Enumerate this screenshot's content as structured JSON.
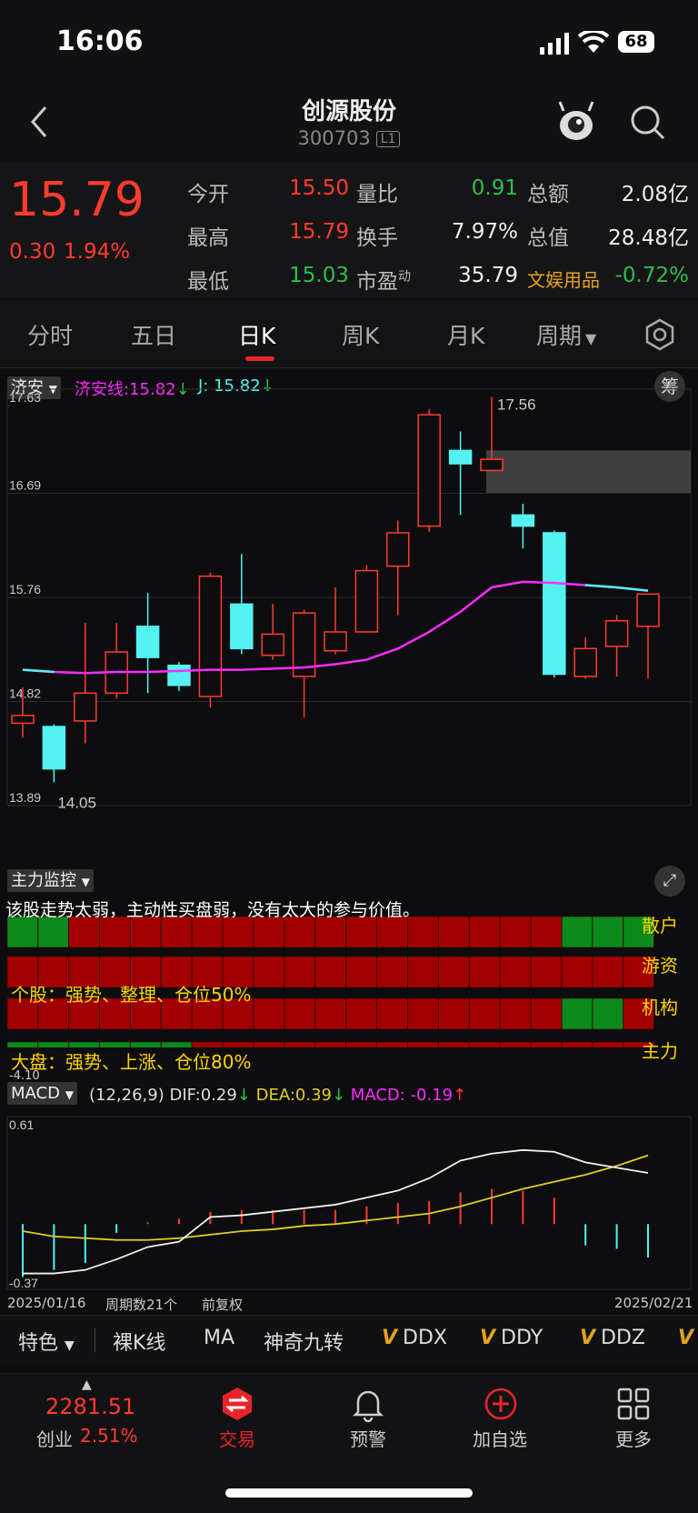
{
  "status": {
    "time": "16:06",
    "battery": "68"
  },
  "header": {
    "title": "创源股份",
    "code": "300703",
    "level": "L1"
  },
  "quote": {
    "price": "15.79",
    "change": "0.30",
    "change_pct": "1.94%",
    "open_label": "今开",
    "open": "15.50",
    "high_label": "最高",
    "high": "15.79",
    "low_label": "最低",
    "low": "15.03",
    "vr_label": "量比",
    "vr": "0.91",
    "turnover_label": "换手",
    "turnover": "7.97%",
    "pe_label": "市盈",
    "pe_sup": "动",
    "pe": "35.79",
    "amount_label": "总额",
    "amount": "2.08亿",
    "mcap_label": "总值",
    "mcap": "28.48亿",
    "sector_label": "文娱用品",
    "sector": "-0.72%"
  },
  "tabs": [
    "分时",
    "五日",
    "日K",
    "周K",
    "月K",
    "周期"
  ],
  "colors": {
    "up": "#ff3b30",
    "down": "#54f2f2",
    "ma": "#ff2bff",
    "accent": "#e8242a"
  },
  "indicator_main": {
    "name": "济安",
    "line_label": "济安线:",
    "line_value": "15.82",
    "j_label": "J:",
    "j_value": "15.82",
    "chip_btn": "筹",
    "y_labels": [
      "17.63",
      "16.69",
      "15.76",
      "14.82",
      "13.89"
    ],
    "max_label": "17.56",
    "min_label": "14.05"
  },
  "chart_data": {
    "type": "candlestick",
    "ylim": [
      13.89,
      17.63
    ],
    "x_start": "2025/01/16",
    "x_end": "2025/02/21",
    "candles": [
      {
        "o": 14.63,
        "c": 14.7,
        "h": 14.95,
        "l": 14.5
      },
      {
        "o": 14.6,
        "c": 14.22,
        "h": 14.62,
        "l": 14.1
      },
      {
        "o": 14.65,
        "c": 14.9,
        "h": 15.53,
        "l": 14.45
      },
      {
        "o": 14.9,
        "c": 15.27,
        "h": 15.53,
        "l": 14.85
      },
      {
        "o": 15.5,
        "c": 15.22,
        "h": 15.8,
        "l": 14.9
      },
      {
        "o": 15.15,
        "c": 14.97,
        "h": 15.18,
        "l": 14.92
      },
      {
        "o": 14.87,
        "c": 15.95,
        "h": 15.98,
        "l": 14.77
      },
      {
        "o": 15.7,
        "c": 15.3,
        "h": 16.15,
        "l": 15.25
      },
      {
        "o": 15.24,
        "c": 15.43,
        "h": 15.7,
        "l": 15.2
      },
      {
        "o": 15.05,
        "c": 15.62,
        "h": 15.65,
        "l": 14.68
      },
      {
        "o": 15.28,
        "c": 15.45,
        "h": 15.85,
        "l": 15.25
      },
      {
        "o": 15.45,
        "c": 16.0,
        "h": 16.05,
        "l": 15.45
      },
      {
        "o": 16.04,
        "c": 16.34,
        "h": 16.45,
        "l": 15.6
      },
      {
        "o": 16.4,
        "c": 17.4,
        "h": 17.45,
        "l": 16.35
      },
      {
        "o": 17.08,
        "c": 16.96,
        "h": 17.25,
        "l": 16.5
      },
      {
        "o": 16.9,
        "c": 17.0,
        "h": 17.56,
        "l": 16.9
      },
      {
        "o": 16.5,
        "c": 16.4,
        "h": 16.6,
        "l": 16.2
      },
      {
        "o": 16.34,
        "c": 15.07,
        "h": 16.36,
        "l": 15.04
      },
      {
        "o": 15.05,
        "c": 15.3,
        "h": 15.4,
        "l": 15.03
      },
      {
        "o": 15.32,
        "c": 15.55,
        "h": 15.6,
        "l": 15.05
      },
      {
        "o": 15.5,
        "c": 15.79,
        "h": 15.79,
        "l": 15.03
      }
    ],
    "jian_line": [
      15.11,
      15.09,
      15.08,
      15.09,
      15.09,
      15.1,
      15.11,
      15.11,
      15.12,
      15.13,
      15.16,
      15.2,
      15.3,
      15.45,
      15.63,
      15.85,
      15.9,
      15.89,
      15.87,
      15.85,
      15.82
    ],
    "macd": {
      "ylim": [
        -0.37,
        0.61
      ],
      "dif": [
        -0.28,
        -0.28,
        -0.26,
        -0.2,
        -0.13,
        -0.1,
        0.04,
        0.05,
        0.07,
        0.09,
        0.11,
        0.15,
        0.19,
        0.26,
        0.36,
        0.4,
        0.42,
        0.41,
        0.35,
        0.32,
        0.29
      ],
      "dea": [
        -0.04,
        -0.07,
        -0.08,
        -0.09,
        -0.09,
        -0.08,
        -0.06,
        -0.04,
        -0.03,
        -0.01,
        0.0,
        0.02,
        0.04,
        0.06,
        0.1,
        0.15,
        0.2,
        0.24,
        0.28,
        0.33,
        0.39
      ],
      "hist": [
        -0.3,
        -0.26,
        -0.22,
        -0.05,
        0.01,
        0.03,
        0.07,
        0.08,
        0.08,
        0.08,
        0.08,
        0.1,
        0.12,
        0.13,
        0.18,
        0.2,
        0.19,
        0.15,
        -0.12,
        -0.14,
        -0.19
      ]
    }
  },
  "monitor": {
    "name": "主力监控",
    "comment": "该股走势太弱，主动性买盘弱，没有太大的参与价值。",
    "stock_text": "个股：强势、整理、仓位50%",
    "market_text": "大盘：强势、上涨、仓位80%",
    "rows": [
      {
        "label": "散户",
        "cells": "GGRRRRRRRRRRRRRRRRGGG"
      },
      {
        "label": "游资",
        "cells": "RRRRRRRRRRRRRRRRRRRRR"
      },
      {
        "label": "机构",
        "cells": "RRRRRRRRRRRRRRRRRRGGR"
      },
      {
        "label": "主力",
        "cells": "GGGGGGRRRRRRRRRRRRRRR"
      }
    ],
    "small_value": "-4.10"
  },
  "macd": {
    "name": "MACD",
    "params": "(12,26,9)",
    "dif_label": "DIF:",
    "dif": "0.29",
    "dea_label": "DEA:",
    "dea": "0.39",
    "macd_label": "MACD:",
    "macd": "-0.19",
    "y_top": "0.61",
    "y_bottom": "-0.37"
  },
  "footer_info": {
    "start": "2025/01/16",
    "periods": "周期数21个",
    "adjust": "前复权",
    "end": "2025/02/21"
  },
  "toolbar": [
    "特色",
    "裸K线",
    "MA",
    "神奇九转",
    "DDX",
    "DDY",
    "DDZ"
  ],
  "bottom": {
    "index_value": "2281.51",
    "index_name": "创业",
    "index_pct": "2.51%",
    "trade": "交易",
    "alert": "预警",
    "add": "加自选",
    "more": "更多"
  }
}
